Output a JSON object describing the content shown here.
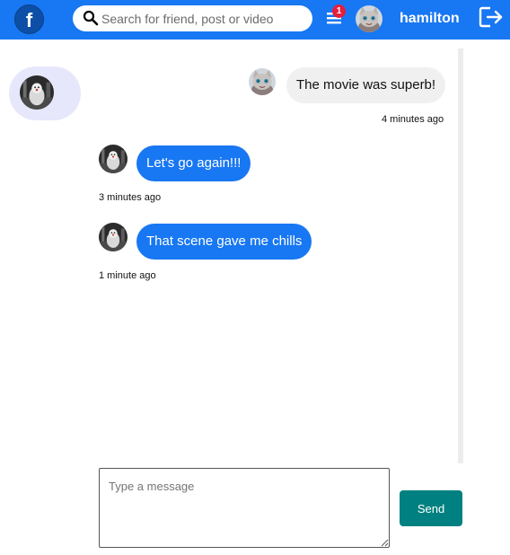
{
  "header": {
    "logo_letter": "f",
    "search_placeholder": "Search for friend, post or video",
    "notification_count": "1",
    "username": "hamilton"
  },
  "conversations": [
    {
      "avatar": "friend-avatar"
    }
  ],
  "messages": [
    {
      "sender": "me",
      "avatar": "own-avatar",
      "text": "The movie was superb!",
      "time": "4 minutes ago"
    },
    {
      "sender": "friend",
      "avatar": "friend-avatar",
      "text": "Let's go again!!!",
      "time": "3 minutes ago"
    },
    {
      "sender": "friend",
      "avatar": "friend-avatar",
      "text": "That scene gave me chills",
      "time": "1 minute ago"
    }
  ],
  "composer": {
    "placeholder": "Type a message",
    "send_label": "Send"
  },
  "colors": {
    "brand": "#1877f2",
    "own_bubble": "#f1f0f0",
    "friend_bubble": "#1877f2",
    "send_button": "#008080",
    "badge": "#e41e3f",
    "active_conversation": "#e6e7fb"
  }
}
